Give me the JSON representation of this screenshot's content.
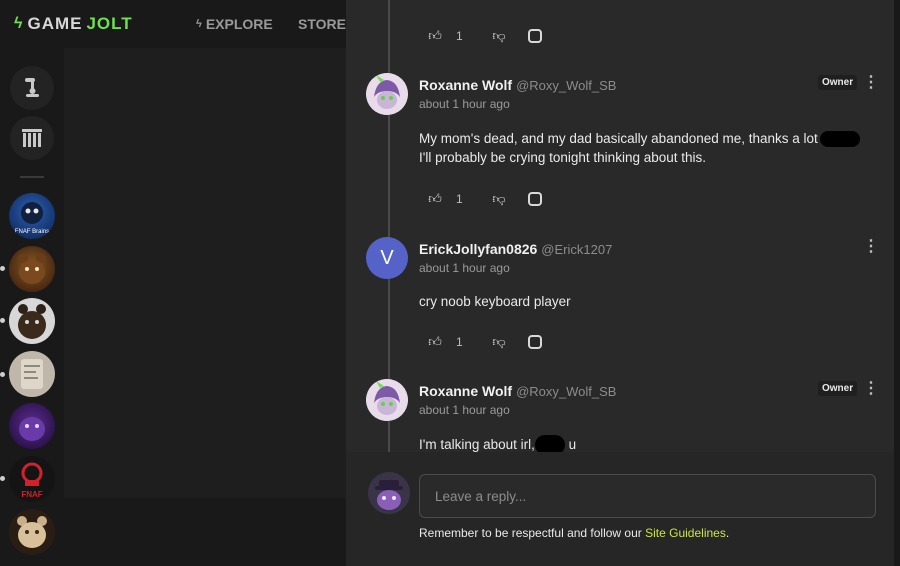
{
  "brand": {
    "logo_game": "GAME",
    "logo_jolt": "JOLT"
  },
  "nav": {
    "explore": "EXPLORE",
    "store": "STORE"
  },
  "colors": {
    "accent": "#6fe04e",
    "link": "#c9e640",
    "panel": "#292929",
    "page": "#191919",
    "letter_avatar": "#5562c8"
  },
  "sidebar": {
    "buttons": [
      {
        "icon": "discover-icon"
      },
      {
        "icon": "library-icon"
      }
    ],
    "communities": [
      {
        "label": "FNAF Brains"
      },
      {
        "label": ""
      },
      {
        "label": ""
      },
      {
        "label": ""
      },
      {
        "label": ""
      },
      {
        "label": "FNAF"
      },
      {
        "label": ""
      }
    ]
  },
  "comments": [
    {
      "likes": "1"
    },
    {
      "user": "Roxanne Wolf",
      "handle": "@Roxy_Wolf_SB",
      "time": "about 1 hour ago",
      "badge": "Owner",
      "text_line1": "My mom's dead, and my dad basically abandoned me, thanks a lot",
      "text_line2": "I'll probably be crying tonight thinking about this.",
      "likes": "1"
    },
    {
      "user": "ErickJollyfan0826",
      "handle": "@Erick1207",
      "avatar_letter": "V",
      "time": "about 1 hour ago",
      "text": "cry noob keyboard player",
      "likes": "1"
    },
    {
      "user": "Roxanne Wolf",
      "handle": "@Roxy_Wolf_SB",
      "time": "about 1 hour ago",
      "badge": "Owner",
      "text_before": "I'm talking about irl,",
      "text_after": "u"
    }
  ],
  "reply": {
    "placeholder": "Leave a reply...",
    "guidelines_prefix": "Remember to be respectful and follow our",
    "guidelines_link": "Site Guidelines",
    "guidelines_suffix": "."
  }
}
